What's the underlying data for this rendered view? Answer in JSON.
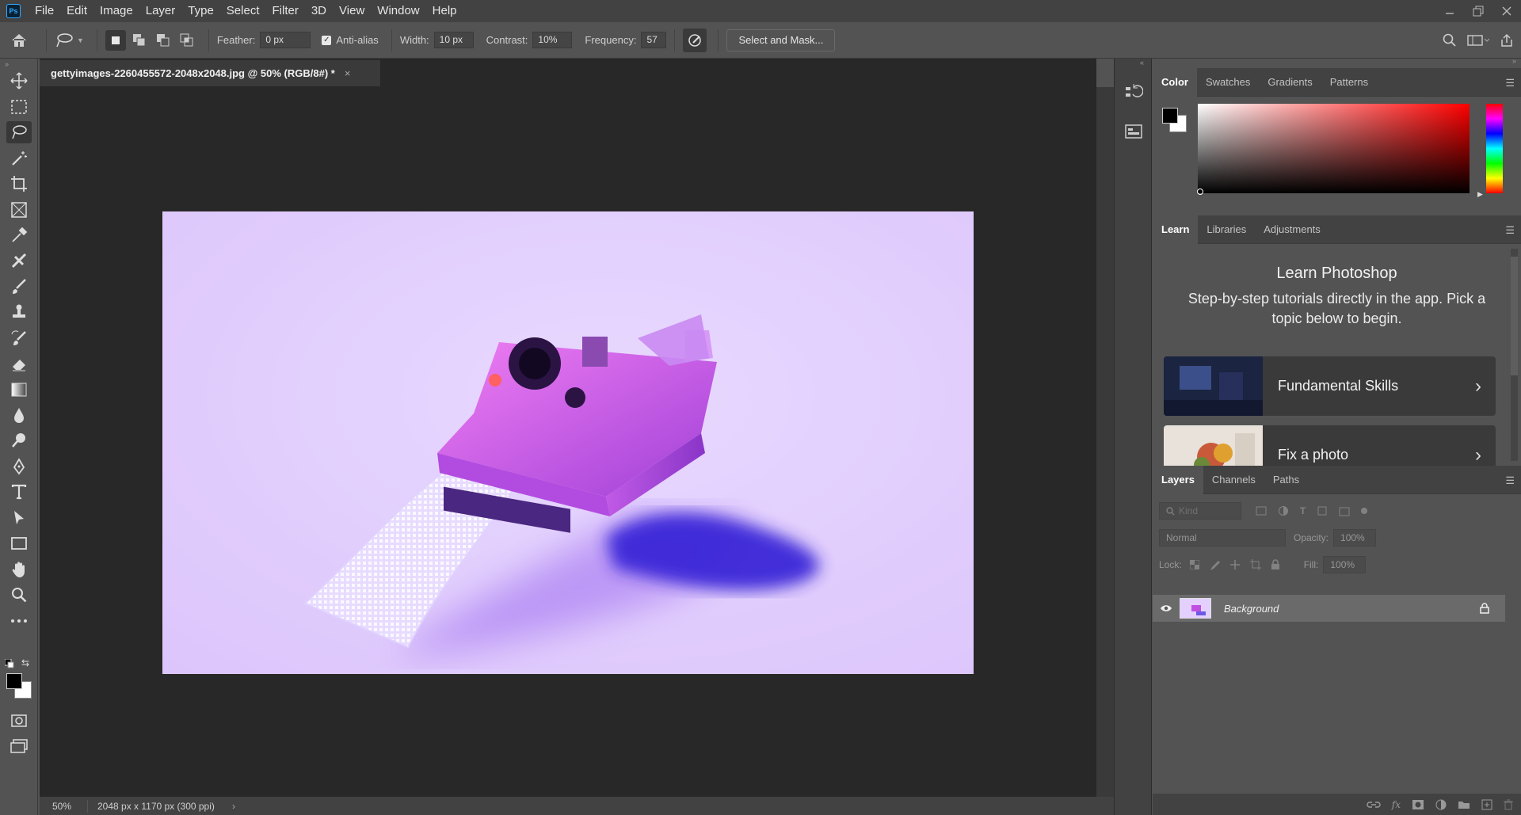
{
  "app": {
    "logo": "Ps"
  },
  "menu": [
    "File",
    "Edit",
    "Image",
    "Layer",
    "Type",
    "Select",
    "Filter",
    "3D",
    "View",
    "Window",
    "Help"
  ],
  "options": {
    "feather_label": "Feather:",
    "feather_value": "0 px",
    "antialias_label": "Anti-alias",
    "antialias_checked": true,
    "width_label": "Width:",
    "width_value": "10 px",
    "contrast_label": "Contrast:",
    "contrast_value": "10%",
    "frequency_label": "Frequency:",
    "frequency_value": "57",
    "select_mask_label": "Select and Mask..."
  },
  "document": {
    "tab_title": "gettyimages-2260455572-2048x2048.jpg @ 50% (RGB/8#) *",
    "close_glyph": "×",
    "zoom": "50%",
    "info": "2048 px x 1170 px (300 ppi)",
    "more_glyph": "›"
  },
  "color_panel": {
    "tabs": [
      "Color",
      "Swatches",
      "Gradients",
      "Patterns"
    ],
    "foreground": "#000000",
    "background": "#ffffff",
    "hue": "#ff0000"
  },
  "learn_panel": {
    "tabs": [
      "Learn",
      "Libraries",
      "Adjustments"
    ],
    "title": "Learn Photoshop",
    "subtitle": "Step-by-step tutorials directly in the app. Pick a topic below to begin.",
    "cards": [
      {
        "label": "Fundamental Skills"
      },
      {
        "label": "Fix a photo"
      }
    ]
  },
  "layers_panel": {
    "tabs": [
      "Layers",
      "Channels",
      "Paths"
    ],
    "kind_placeholder": "Kind",
    "blend_mode": "Normal",
    "opacity_label": "Opacity:",
    "opacity_value": "100%",
    "lock_label": "Lock:",
    "fill_label": "Fill:",
    "fill_value": "100%",
    "layers": [
      {
        "name": "Background",
        "visible": true,
        "locked": true
      }
    ]
  },
  "tools": [
    "move-tool",
    "marquee-tool",
    "lasso-tool",
    "magic-wand-tool",
    "crop-tool",
    "frame-tool",
    "eyedropper-tool",
    "healing-tool",
    "brush-tool",
    "stamp-tool",
    "history-brush-tool",
    "eraser-tool",
    "gradient-tool",
    "blur-tool",
    "dodge-tool",
    "pen-tool",
    "type-tool",
    "path-select-tool",
    "rectangle-tool",
    "hand-tool",
    "zoom-tool",
    "more-tools"
  ],
  "active_tool": "lasso-tool"
}
